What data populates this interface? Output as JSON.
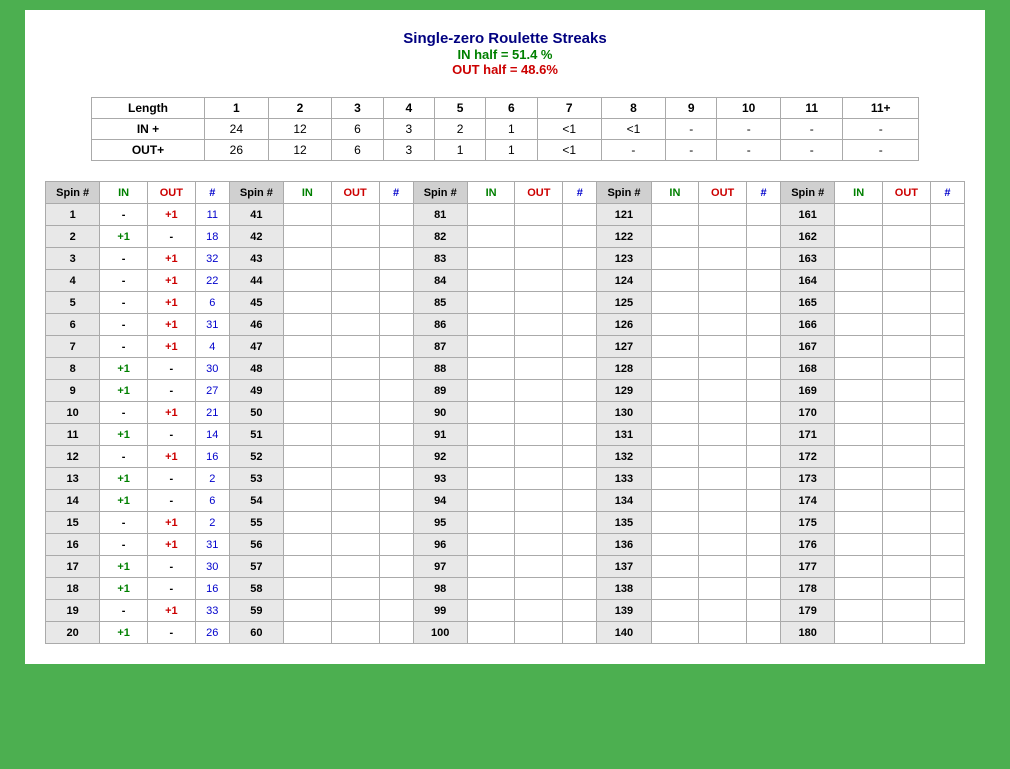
{
  "title": "Single-zero Roulette Streaks",
  "in_half": "IN half = 51.4 %",
  "out_half": "OUT half = 48.6%",
  "summary": {
    "headers": [
      "Length",
      "1",
      "2",
      "3",
      "4",
      "5",
      "6",
      "7",
      "8",
      "9",
      "10",
      "11",
      "11+"
    ],
    "rows": [
      [
        "IN +",
        "24",
        "12",
        "6",
        "3",
        "2",
        "1",
        "<1",
        "<1",
        "-",
        "-",
        "-",
        "-"
      ],
      [
        "OUT+",
        "26",
        "12",
        "6",
        "3",
        "1",
        "1",
        "<1",
        "-",
        "-",
        "-",
        "-",
        "-"
      ]
    ]
  },
  "spin_data": [
    {
      "spin": 1,
      "in": "-",
      "out": "+1",
      "hash": "11"
    },
    {
      "spin": 2,
      "in": "+1",
      "out": "-",
      "hash": "18"
    },
    {
      "spin": 3,
      "in": "-",
      "out": "+1",
      "hash": "32"
    },
    {
      "spin": 4,
      "in": "-",
      "out": "+1",
      "hash": "22"
    },
    {
      "spin": 5,
      "in": "-",
      "out": "+1",
      "hash": "6"
    },
    {
      "spin": 6,
      "in": "-",
      "out": "+1",
      "hash": "31"
    },
    {
      "spin": 7,
      "in": "-",
      "out": "+1",
      "hash": "4"
    },
    {
      "spin": 8,
      "in": "+1",
      "out": "-",
      "hash": "30"
    },
    {
      "spin": 9,
      "in": "+1",
      "out": "-",
      "hash": "27"
    },
    {
      "spin": 10,
      "in": "-",
      "out": "+1",
      "hash": "21"
    },
    {
      "spin": 11,
      "in": "+1",
      "out": "-",
      "hash": "14"
    },
    {
      "spin": 12,
      "in": "-",
      "out": "+1",
      "hash": "16"
    },
    {
      "spin": 13,
      "in": "+1",
      "out": "-",
      "hash": "2"
    },
    {
      "spin": 14,
      "in": "+1",
      "out": "-",
      "hash": "6"
    },
    {
      "spin": 15,
      "in": "-",
      "out": "+1",
      "hash": "2"
    },
    {
      "spin": 16,
      "in": "-",
      "out": "+1",
      "hash": "31"
    },
    {
      "spin": 17,
      "in": "+1",
      "out": "-",
      "hash": "30"
    },
    {
      "spin": 18,
      "in": "+1",
      "out": "-",
      "hash": "16"
    },
    {
      "spin": 19,
      "in": "-",
      "out": "+1",
      "hash": "33"
    },
    {
      "spin": 20,
      "in": "+1",
      "out": "-",
      "hash": "26"
    }
  ]
}
